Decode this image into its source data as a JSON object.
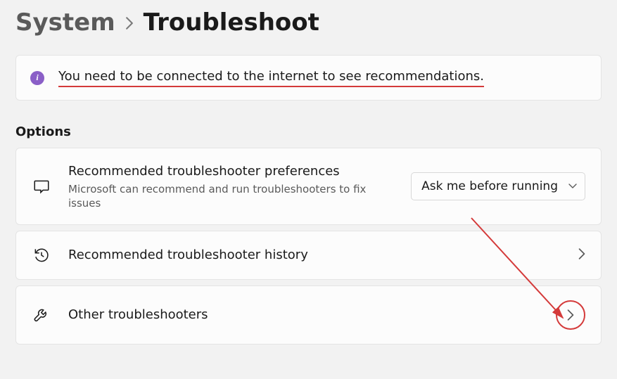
{
  "breadcrumb": {
    "parent": "System",
    "current": "Troubleshoot"
  },
  "banner": {
    "text": "You need to be connected to the internet to see recommendations."
  },
  "section_title": "Options",
  "cards": {
    "preferences": {
      "title": "Recommended troubleshooter preferences",
      "subtitle": "Microsoft can recommend and run troubleshooters to fix issues",
      "dropdown_value": "Ask me before running"
    },
    "history": {
      "title": "Recommended troubleshooter history"
    },
    "other": {
      "title": "Other troubleshooters"
    }
  }
}
